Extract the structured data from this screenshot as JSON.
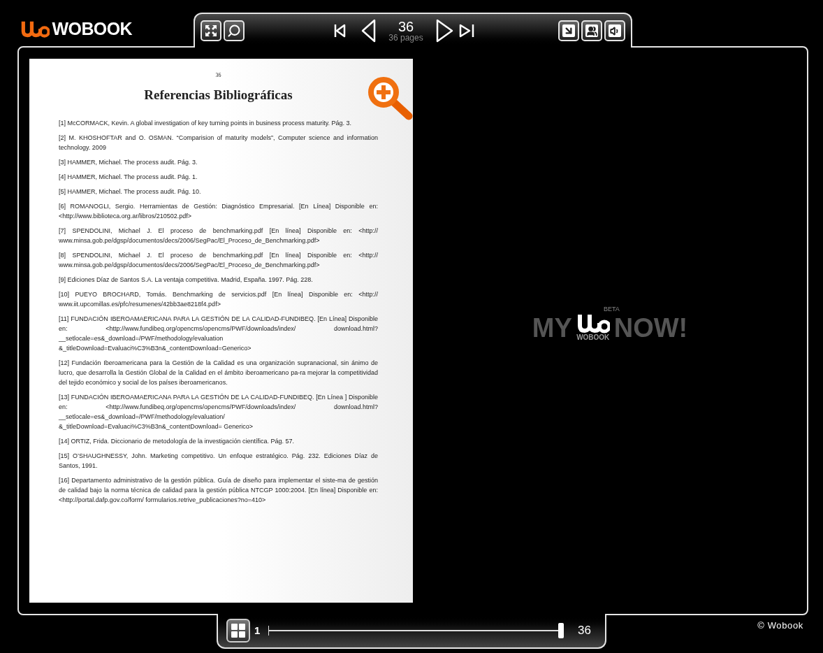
{
  "header": {
    "logo_text": "WOBOOK"
  },
  "toolbar": {
    "current_page": "36",
    "page_count": "36 pages"
  },
  "page": {
    "number": "36",
    "title": "Referencias Bibliográficas",
    "references": [
      "[1] McCORMACK, Kevin. A global investigation of key turning points in business process maturity. Pág. 3.",
      "[2] M. KHOSHOFTAR and O. OSMAN. “Comparision of maturity models”, Computer science and information technology. 2009",
      "[3] HAMMER, Michael. The process audit. Pág. 3.",
      "[4] HAMMER, Michael. The process audit. Pág. 1.",
      "[5] HAMMER, Michael. The process audit. Pág. 10.",
      "[6] ROMANOGLI, Sergio. Herramientas de Gestión: Diagnóstico Empresarial. [En Línea] Disponible en: <http://www.biblioteca.org.ar/libros/210502.pdf>",
      "[7] SPENDOLINI, Michael J. El proceso de benchmarking.pdf [En línea] Disponible en: <http:// www.minsa.gob.pe/dgsp/documentos/decs/2006/SegPac/El_Proceso_de_Benchmarking.pdf>",
      "[8] SPENDOLINI, Michael J. El proceso de benchmarking.pdf [En línea] Disponible en: <http:// www.minsa.gob.pe/dgsp/documentos/decs/2006/SegPac/El_Proceso_de_Benchmarking.pdf>",
      "[9] Ediciones Díaz de Santos S.A. La ventaja competitiva. Madrid, España. 1997. Pág. 228.",
      "[10] PUEYO BROCHARD, Tomás. Benchmarking de servicios.pdf [En línea] Disponible en: <http:// www.iit.upcomillas.es/pfc/resumenes/42bb3ae8218f4.pdf>",
      "[11] FUNDACIÓN IBEROAMAERICANA PARA LA GESTIÓN DE LA CALIDAD-FUNDIBEQ. [En Línea] Disponible en: <http://www.fundibeq.org/opencms/opencms/PWF/downloads/index/ download.html?__setlocale=es&_download=/PWF/methodology/evaluation &_titleDownload=Evaluaci%C3%B3n&_contentDownload=Generico>",
      "[12] Fundación Iberoamericana para la Gestión de la Calidad es una organización supranacional, sin ánimo de lucro, que desarrolla la Gestión Global de la Calidad en el ámbito iberoamericano pa-ra mejorar la competitividad del tejido económico y social de los países iberoamericanos.",
      "[13] FUNDACIÓN IBEROAMAERICANA PARA LA GESTIÓN DE LA CALIDAD-FUNDIBEQ. [En Línea ] Disponible en: <http://www.fundibeq.org/opencms/opencms/PWF/downloads/index/ download.html?__setlocale=es&_download=/PWF/methodology/evaluation/ &_titleDownload=Evaluaci%C3%B3n&_contentDownload= Generico>",
      "[14] ORTIZ, Frida. Diccionario de metodología de la investigación científica. Pág. 57.",
      "[15] O’SHAUGHNESSY, John. Marketing competitivo. Un enfoque estratégico. Pág. 232. Ediciones Díaz de Santos, 1991.",
      "[16] Departamento administrativo de la gestión pública. Guía de diseño para implementar el siste-ma de gestión de calidad bajo la norma técnica de calidad para la gestión pública NTCGP 1000:2004. [En línea] Disponible en: <http://portal.dafp.gov.co/form/ formularios.retrive_publicaciones?no=410>"
    ]
  },
  "splash": {
    "left": "MY",
    "right": "NOW!",
    "badge": "BETA",
    "logo_text": "WOBOOK"
  },
  "navigator": {
    "start": "1",
    "end": "36",
    "level": 1
  },
  "copyright": "© Wobook"
}
